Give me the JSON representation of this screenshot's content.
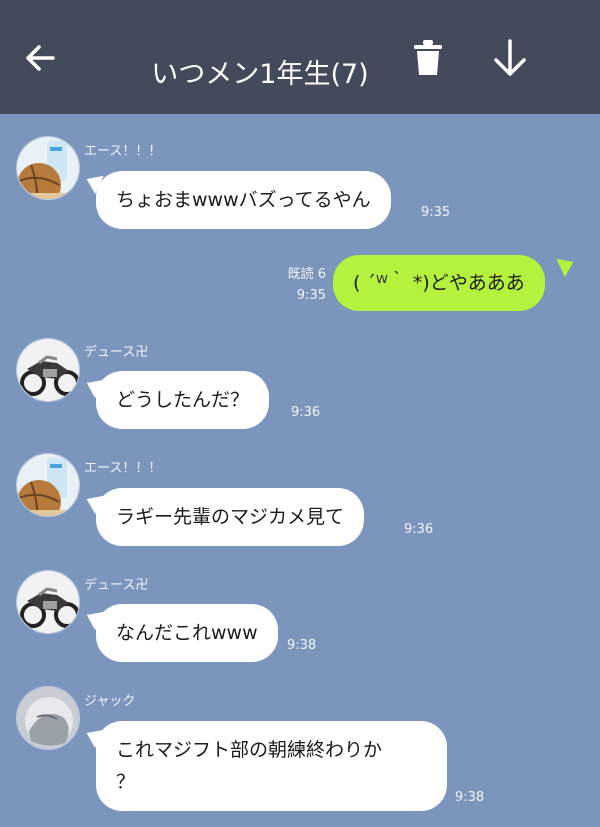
{
  "header": {
    "back_icon": "arrow-left-icon",
    "title": "いつメン1年生(7)",
    "trash_icon": "trash-icon",
    "download_icon": "arrow-down-icon",
    "bg_color": "#434a5b"
  },
  "chat_bg": "#7b95bd",
  "messages": [
    {
      "sender": "エース！！！",
      "text": "ちょおまwwwバズってるやん",
      "time": "9:35"
    },
    {
      "read": "既読 6",
      "text": "( ´ᵂ｀ *)どやあああ",
      "time": "9:35"
    },
    {
      "sender": "デュース卍",
      "text": "どうしたんだ？",
      "time": "9:36"
    },
    {
      "sender": "エース！！！",
      "text": "ラギー先輩のマジカメ見て",
      "time": "9:36"
    },
    {
      "sender": "デュース卍",
      "text": "なんだこれwww",
      "time": "9:38"
    },
    {
      "sender": "ジャック",
      "text_line1": "これマジフト部の朝練終わりか",
      "text_line2": "？",
      "time": "9:38"
    }
  ],
  "colors": {
    "incoming_bubble": "#ffffff",
    "outgoing_bubble": "#b4f23d"
  }
}
